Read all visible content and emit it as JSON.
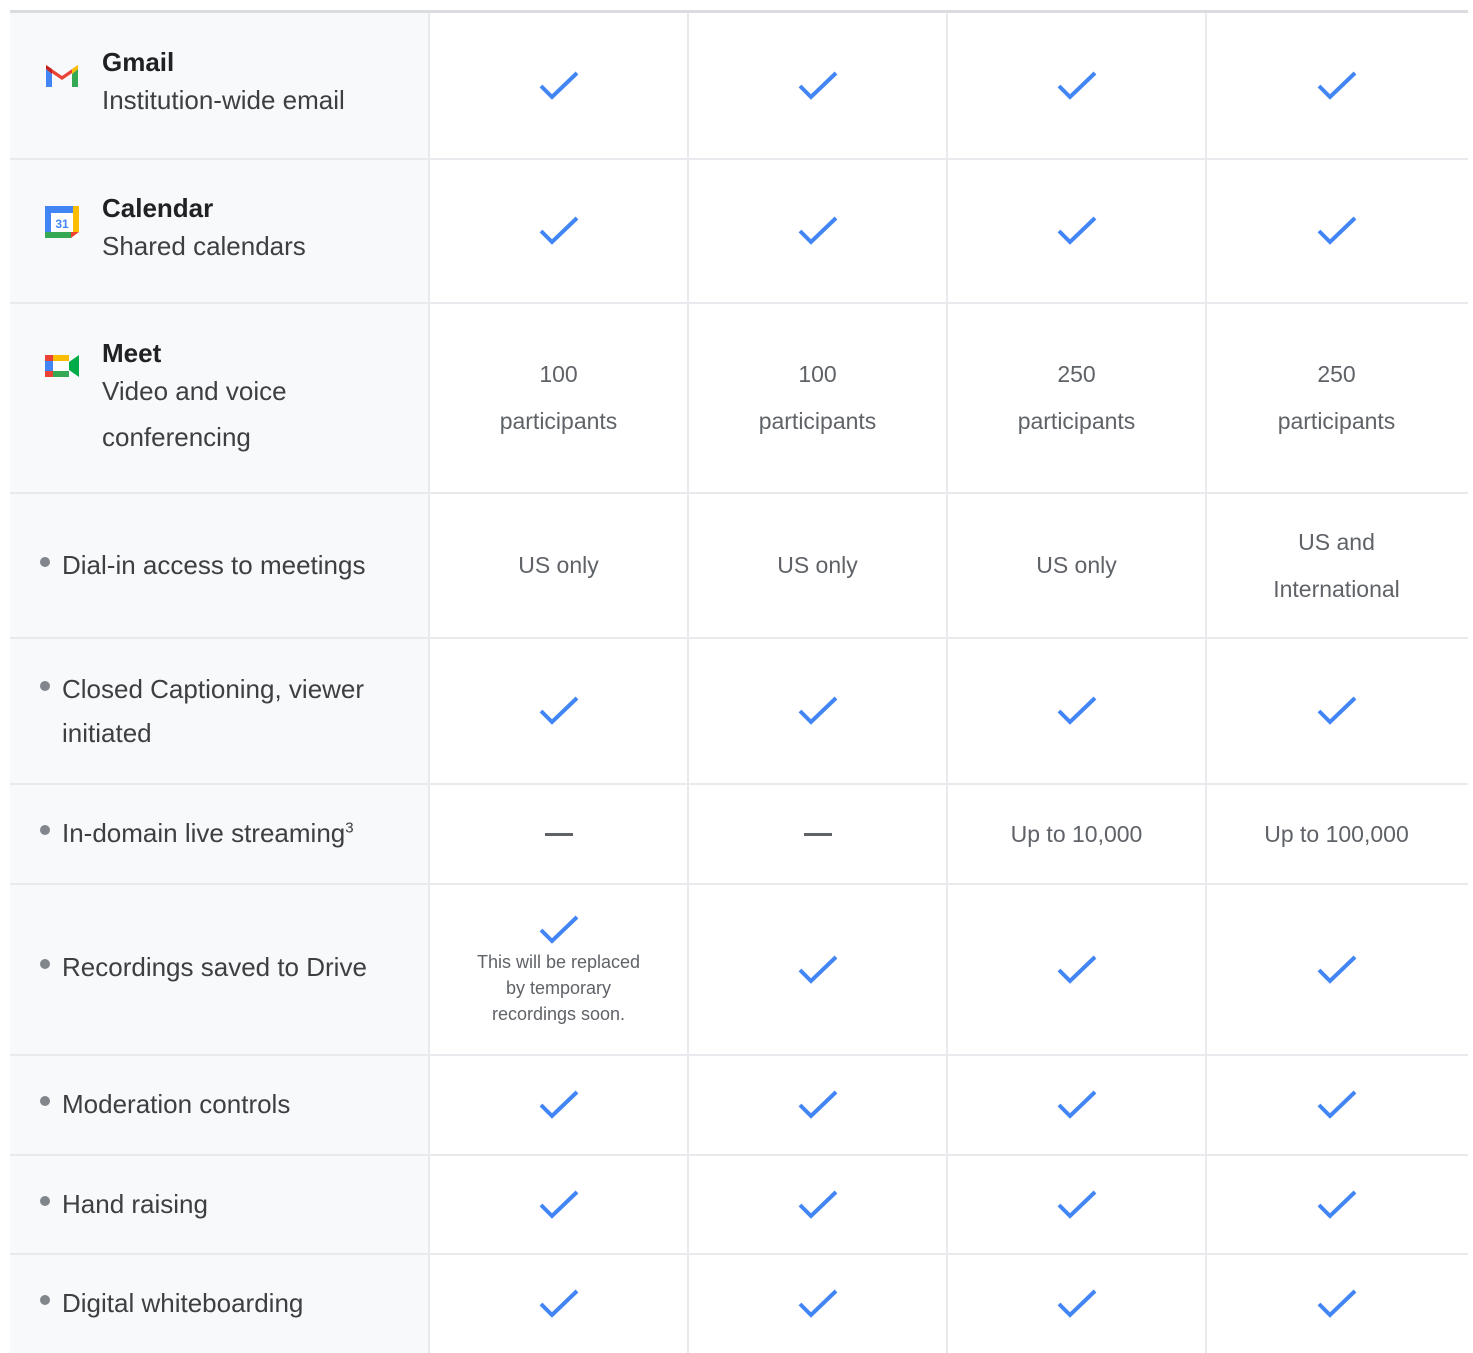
{
  "colors": {
    "check": "#4285f4",
    "feature_bg": "#f8f9fa",
    "border": "#e8eaed"
  },
  "products": {
    "gmail": {
      "name": "Gmail",
      "desc": "Institution-wide email",
      "icon": "gmail-icon"
    },
    "calendar": {
      "name": "Calendar",
      "desc": "Shared calendars",
      "icon": "calendar-icon",
      "icon_text": "31"
    },
    "meet": {
      "name": "Meet",
      "desc_line1": "Video and voice",
      "desc_line2": "conferencing",
      "icon": "meet-icon"
    }
  },
  "meet_participants": [
    {
      "count": "100",
      "unit": "participants"
    },
    {
      "count": "100",
      "unit": "participants"
    },
    {
      "count": "250",
      "unit": "participants"
    },
    {
      "count": "250",
      "unit": "participants"
    }
  ],
  "features": {
    "dial_in": {
      "label": "Dial-in access to meetings",
      "values": [
        "US only",
        "US only",
        "US only"
      ],
      "intl_line1": "US and",
      "intl_line2": "International"
    },
    "captioning": {
      "label_line1": "Closed Captioning, viewer",
      "label_line2": "initiated"
    },
    "streaming": {
      "label": "In-domain live streaming",
      "footnote": "3",
      "values": [
        "Up to 10,000",
        "Up to 100,000"
      ]
    },
    "recordings": {
      "label": "Recordings saved to Drive",
      "note_line1": "This will be replaced",
      "note_line2": "by temporary",
      "note_line3": "recordings soon."
    },
    "moderation": {
      "label": "Moderation controls"
    },
    "hand_raising": {
      "label": "Hand raising"
    },
    "whiteboarding": {
      "label": "Digital whiteboarding"
    }
  }
}
